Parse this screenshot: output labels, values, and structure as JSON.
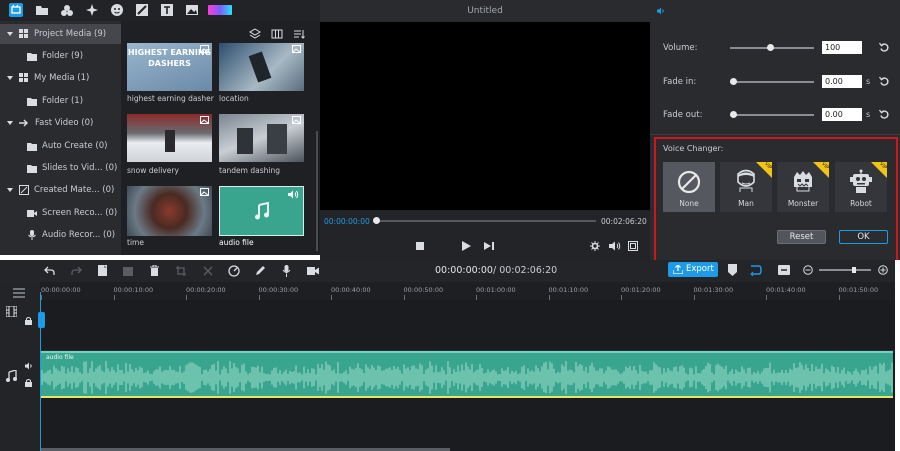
{
  "toolbar": {
    "icons": [
      "media-icon",
      "folder-icon",
      "effects-icon",
      "transitions-icon",
      "stickers-icon",
      "split-icon",
      "text-icon",
      "image-icon",
      "color-icon"
    ]
  },
  "sidebar": {
    "items": [
      {
        "label": "Project Media (9)",
        "level": 0
      },
      {
        "label": "Folder (9)",
        "level": 1
      },
      {
        "label": "My Media (1)",
        "level": 0
      },
      {
        "label": "Folder (1)",
        "level": 1
      },
      {
        "label": "Fast Video (0)",
        "level": 0
      },
      {
        "label": "Auto Create (0)",
        "level": 1
      },
      {
        "label": "Slides to Vid... (0)",
        "level": 1
      },
      {
        "label": "Created Mate... (0)",
        "level": 0
      },
      {
        "label": "Screen Reco... (0)",
        "level": 1
      },
      {
        "label": "Audio Recor... (0)",
        "level": 1
      }
    ]
  },
  "media": {
    "items": [
      {
        "label": "highest earning dasher",
        "overlay": "HIGHEST EARNING DASHERS"
      },
      {
        "label": "location"
      },
      {
        "label": "snow delivery"
      },
      {
        "label": "tandem dashing"
      },
      {
        "label": "time"
      },
      {
        "label": "audio file"
      }
    ]
  },
  "preview": {
    "title": "Untitled",
    "current_time": "00:00:00:00",
    "total_time": "00:02:06:20"
  },
  "panel": {
    "volume_label": "Volume:",
    "volume_value": "100",
    "fade_in_label": "Fade in:",
    "fade_in_value": "0.00",
    "fade_out_label": "Fade out:",
    "fade_out_value": "0.00",
    "unit": "s",
    "voice_changer_label": "Voice Changer:",
    "voices": [
      {
        "name": "None",
        "vip": false
      },
      {
        "name": "Man",
        "vip": true
      },
      {
        "name": "Monster",
        "vip": true
      },
      {
        "name": "Robot",
        "vip": true
      }
    ],
    "vip_text": "VIP",
    "reset_label": "Reset",
    "ok_label": "OK",
    "export_label": "Export",
    "volume_level": 0.9,
    "fade_in_level": 0,
    "fade_out_level": 0
  },
  "timeline": {
    "timecode": "00:00:00:00",
    "total": "/ 00:02:06:20",
    "ticks": [
      "00:00:00:00",
      "00:00:10:00",
      "00:00:20:00",
      "00:00:30:00",
      "00:00:40:00",
      "00:00:50:00",
      "00:01:00:00",
      "00:01:10:00",
      "00:01:20:00",
      "00:01:30:00",
      "00:01:40:00",
      "00:01:50:00"
    ],
    "audio_clip_label": "audio file"
  },
  "colors": {
    "accent": "#1e9be6",
    "audio_clip": "#3aa58e",
    "highlight_box": "#d0161d",
    "vip": "#f0c419"
  }
}
